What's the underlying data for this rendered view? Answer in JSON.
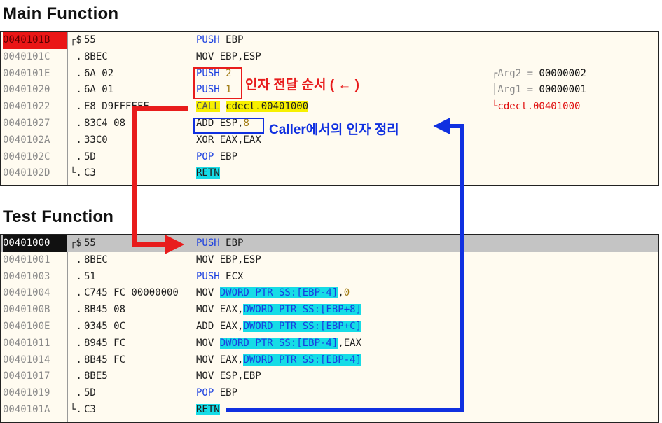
{
  "titles": {
    "main": "Main Function",
    "test": "Test Function"
  },
  "main_rows": [
    {
      "addr": "0040101B",
      "bracket": "┌$",
      "bytes": "55",
      "disasm": [
        {
          "t": "PUSH",
          "c": "kw-blue"
        },
        {
          "t": " EBP",
          "c": ""
        }
      ],
      "cmt": []
    },
    {
      "addr": "0040101C",
      "bracket": " .",
      "bytes": "8BEC",
      "disasm": [
        {
          "t": "MOV EBP,ESP",
          "c": ""
        }
      ],
      "cmt": []
    },
    {
      "addr": "0040101E",
      "bracket": " .",
      "bytes": "6A 02",
      "disasm": [
        {
          "t": "PUSH",
          "c": "kw-blue"
        },
        {
          "t": " 2",
          "c": "num-olive"
        }
      ],
      "cmt": [
        {
          "t": "┌Arg2 = ",
          "c": "cmt-grey"
        },
        {
          "t": "00000002",
          "c": "cmt-black"
        }
      ]
    },
    {
      "addr": "00401020",
      "bracket": " .",
      "bytes": "6A 01",
      "disasm": [
        {
          "t": "PUSH",
          "c": "kw-blue"
        },
        {
          "t": " 1",
          "c": "num-olive"
        }
      ],
      "cmt": [
        {
          "t": "│Arg1 = ",
          "c": "cmt-grey"
        },
        {
          "t": "00000001",
          "c": "cmt-black"
        }
      ]
    },
    {
      "addr": "00401022",
      "bracket": " .",
      "bytes": "E8 D9FFFFFF",
      "disasm": [
        {
          "t": "CALL",
          "c": "hl-yellow kw-grey"
        },
        {
          "t": " ",
          "c": ""
        },
        {
          "t": "cdecl.00401000",
          "c": "hl-yellow"
        }
      ],
      "cmt": [
        {
          "t": "└cdecl.00401000",
          "c": "cmt-red"
        }
      ]
    },
    {
      "addr": "00401027",
      "bracket": " .",
      "bytes": "83C4 08",
      "disasm": [
        {
          "t": "ADD ESP,",
          "c": ""
        },
        {
          "t": "8",
          "c": "num-olive"
        }
      ],
      "cmt": []
    },
    {
      "addr": "0040102A",
      "bracket": " .",
      "bytes": "33C0",
      "disasm": [
        {
          "t": "XOR EAX,EAX",
          "c": ""
        }
      ],
      "cmt": []
    },
    {
      "addr": "0040102C",
      "bracket": " .",
      "bytes": "5D",
      "disasm": [
        {
          "t": "POP",
          "c": "kw-blue"
        },
        {
          "t": " EBP",
          "c": ""
        }
      ],
      "cmt": []
    },
    {
      "addr": "0040102D",
      "bracket": "└.",
      "bytes": "C3",
      "disasm": [
        {
          "t": "RETN",
          "c": "hl-cyan"
        }
      ],
      "cmt": []
    }
  ],
  "test_rows": [
    {
      "addr": "00401000",
      "bracket": "┌$",
      "bytes": "55",
      "disasm": [
        {
          "t": "PUSH",
          "c": "kw-blue"
        },
        {
          "t": " EBP",
          "c": ""
        }
      ]
    },
    {
      "addr": "00401001",
      "bracket": " .",
      "bytes": "8BEC",
      "disasm": [
        {
          "t": "MOV EBP,ESP",
          "c": ""
        }
      ]
    },
    {
      "addr": "00401003",
      "bracket": " .",
      "bytes": "51",
      "disasm": [
        {
          "t": "PUSH",
          "c": "kw-blue"
        },
        {
          "t": " ECX",
          "c": ""
        }
      ]
    },
    {
      "addr": "00401004",
      "bracket": " .",
      "bytes": "C745 FC 00000000",
      "disasm": [
        {
          "t": "MOV ",
          "c": ""
        },
        {
          "t": "DWORD PTR SS:[EBP-4]",
          "c": "hl-cyan kw-blue"
        },
        {
          "t": ",",
          "c": ""
        },
        {
          "t": "0",
          "c": "num-olive"
        }
      ]
    },
    {
      "addr": "0040100B",
      "bracket": " .",
      "bytes": "8B45 08",
      "disasm": [
        {
          "t": "MOV EAX,",
          "c": ""
        },
        {
          "t": "DWORD PTR SS:[EBP+8]",
          "c": "hl-cyan kw-blue"
        }
      ]
    },
    {
      "addr": "0040100E",
      "bracket": " .",
      "bytes": "0345 0C",
      "disasm": [
        {
          "t": "ADD EAX,",
          "c": ""
        },
        {
          "t": "DWORD PTR SS:[EBP+C]",
          "c": "hl-cyan kw-blue"
        }
      ]
    },
    {
      "addr": "00401011",
      "bracket": " .",
      "bytes": "8945 FC",
      "disasm": [
        {
          "t": "MOV ",
          "c": ""
        },
        {
          "t": "DWORD PTR SS:[EBP-4]",
          "c": "hl-cyan kw-blue"
        },
        {
          "t": ",EAX",
          "c": ""
        }
      ]
    },
    {
      "addr": "00401014",
      "bracket": " .",
      "bytes": "8B45 FC",
      "disasm": [
        {
          "t": "MOV EAX,",
          "c": ""
        },
        {
          "t": "DWORD PTR SS:[EBP-4]",
          "c": "hl-cyan kw-blue"
        }
      ]
    },
    {
      "addr": "00401017",
      "bracket": " .",
      "bytes": "8BE5",
      "disasm": [
        {
          "t": "MOV ESP,EBP",
          "c": ""
        }
      ]
    },
    {
      "addr": "00401019",
      "bracket": " .",
      "bytes": "5D",
      "disasm": [
        {
          "t": "POP",
          "c": "kw-blue"
        },
        {
          "t": " EBP",
          "c": ""
        }
      ]
    },
    {
      "addr": "0040101A",
      "bracket": "└.",
      "bytes": "C3",
      "disasm": [
        {
          "t": "RETN",
          "c": "hl-cyan"
        }
      ]
    }
  ],
  "annotations": {
    "arg_order": "인자 전달 순서 ( ← )",
    "caller_cleanup": "Caller에서의 인자 정리"
  },
  "colors": {
    "red": "#e81c1c",
    "blue": "#1030e0",
    "cyan": "#16dce6",
    "yellow": "#f7f000",
    "panel_bg": "#fffbf0"
  }
}
